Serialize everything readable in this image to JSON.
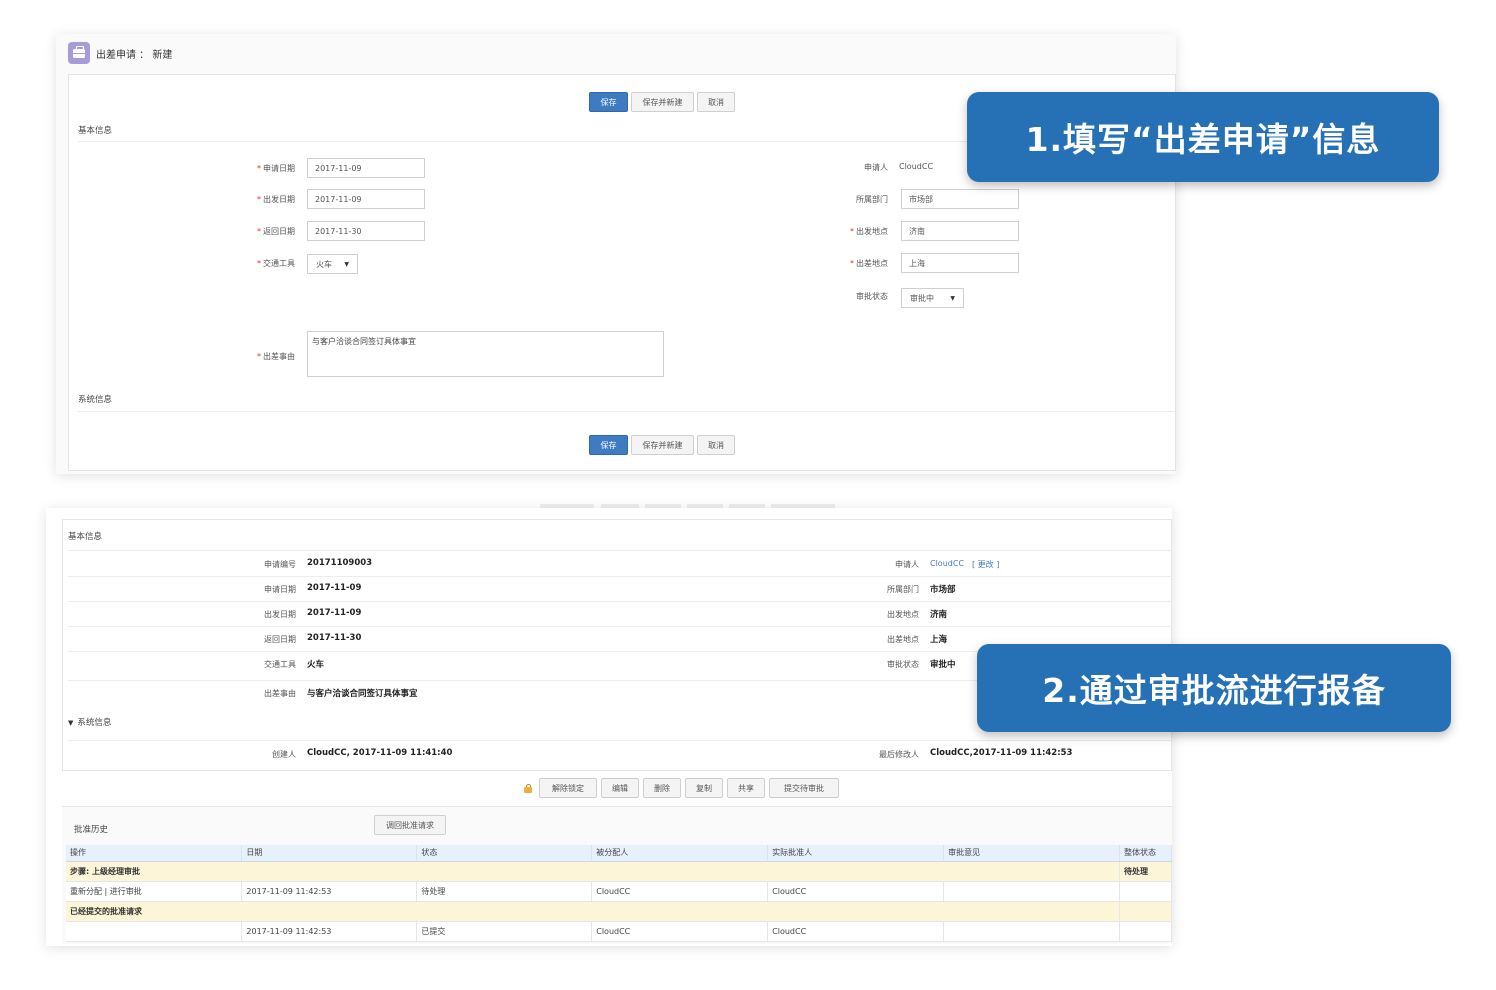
{
  "form": {
    "title": "出差申请 ： 新建",
    "buttons": {
      "save": "保存",
      "save_new": "保存并新建",
      "cancel": "取消"
    },
    "section_basic": "基本信息",
    "section_system": "系统信息",
    "fields": {
      "apply_date": {
        "label": "申请日期",
        "value": "2017-11-09"
      },
      "depart_date": {
        "label": "出发日期",
        "value": "2017-11-09"
      },
      "return_date": {
        "label": "返回日期",
        "value": "2017-11-30"
      },
      "transport": {
        "label": "交通工具",
        "value": "火车"
      },
      "reason": {
        "label": "出差事由",
        "value": "与客户洽谈合同签订具体事宜"
      },
      "applicant": {
        "label": "申请人",
        "value": "CloudCC"
      },
      "department": {
        "label": "所属部门",
        "value": "市场部"
      },
      "depart_place": {
        "label": "出发地点",
        "value": "济南"
      },
      "trip_place": {
        "label": "出差地点",
        "value": "上海"
      },
      "approval_status": {
        "label": "审批状态",
        "value": "审批中"
      }
    },
    "required_mark": "*"
  },
  "callouts": {
    "step1": "1.填写“出差申请”信息",
    "step2": "2.通过审批流进行报备"
  },
  "detail": {
    "section_basic": "基本信息",
    "section_system": "系统信息",
    "rows": {
      "apply_no": {
        "label": "申请编号",
        "value": "20171109003"
      },
      "apply_date": {
        "label": "申请日期",
        "value": "2017-11-09"
      },
      "depart_date": {
        "label": "出发日期",
        "value": "2017-11-09"
      },
      "return_date": {
        "label": "返回日期",
        "value": "2017-11-30"
      },
      "transport": {
        "label": "交通工具",
        "value": "火车"
      },
      "reason": {
        "label": "出差事由",
        "value": "与客户洽谈合同签订具体事宜"
      },
      "applicant": {
        "label": "申请人",
        "value": "CloudCC",
        "change": "[ 更改 ]"
      },
      "department": {
        "label": "所属部门",
        "value": "市场部"
      },
      "depart_place": {
        "label": "出发地点",
        "value": "济南"
      },
      "trip_place": {
        "label": "出差地点",
        "value": "上海"
      },
      "approval_status": {
        "label": "审批状态",
        "value": "审批中"
      },
      "creator": {
        "label": "创建人",
        "value": "CloudCC, 2017-11-09 11:41:40"
      },
      "modifier": {
        "label": "最后修改人",
        "value": "CloudCC,2017-11-09 11:42:53"
      }
    },
    "actions": {
      "unlock": "解除锁定",
      "edit": "编辑",
      "delete": "删除",
      "copy": "复制",
      "share": "共享",
      "submit": "提交待审批"
    },
    "history": {
      "title": "批准历史",
      "recall": "调回批准请求",
      "columns": [
        "操作",
        "日期",
        "状态",
        "被分配人",
        "实际批准人",
        "审批意见",
        "整体状态"
      ],
      "step1": {
        "label": "步骤: 上级经理审批",
        "overall": "待处理"
      },
      "row1": {
        "action": "重新分配 | 进行审批",
        "date": "2017-11-09 11:42:53",
        "status": "待处理",
        "assignee": "CloudCC",
        "approver": "CloudCC",
        "comment": "",
        "overall": ""
      },
      "step2": {
        "label": "已经提交的批准请求",
        "overall": ""
      },
      "row2": {
        "action": "",
        "date": "2017-11-09 11:42:53",
        "status": "已提交",
        "assignee": "CloudCC",
        "approver": "CloudCC",
        "comment": "",
        "overall": ""
      }
    }
  },
  "colors": {
    "primary": "#3e7bc0",
    "callout": "#2670b5",
    "required": "#d9362b",
    "step_row": "#fdf5d8",
    "table_header": "#e6f1fb"
  }
}
